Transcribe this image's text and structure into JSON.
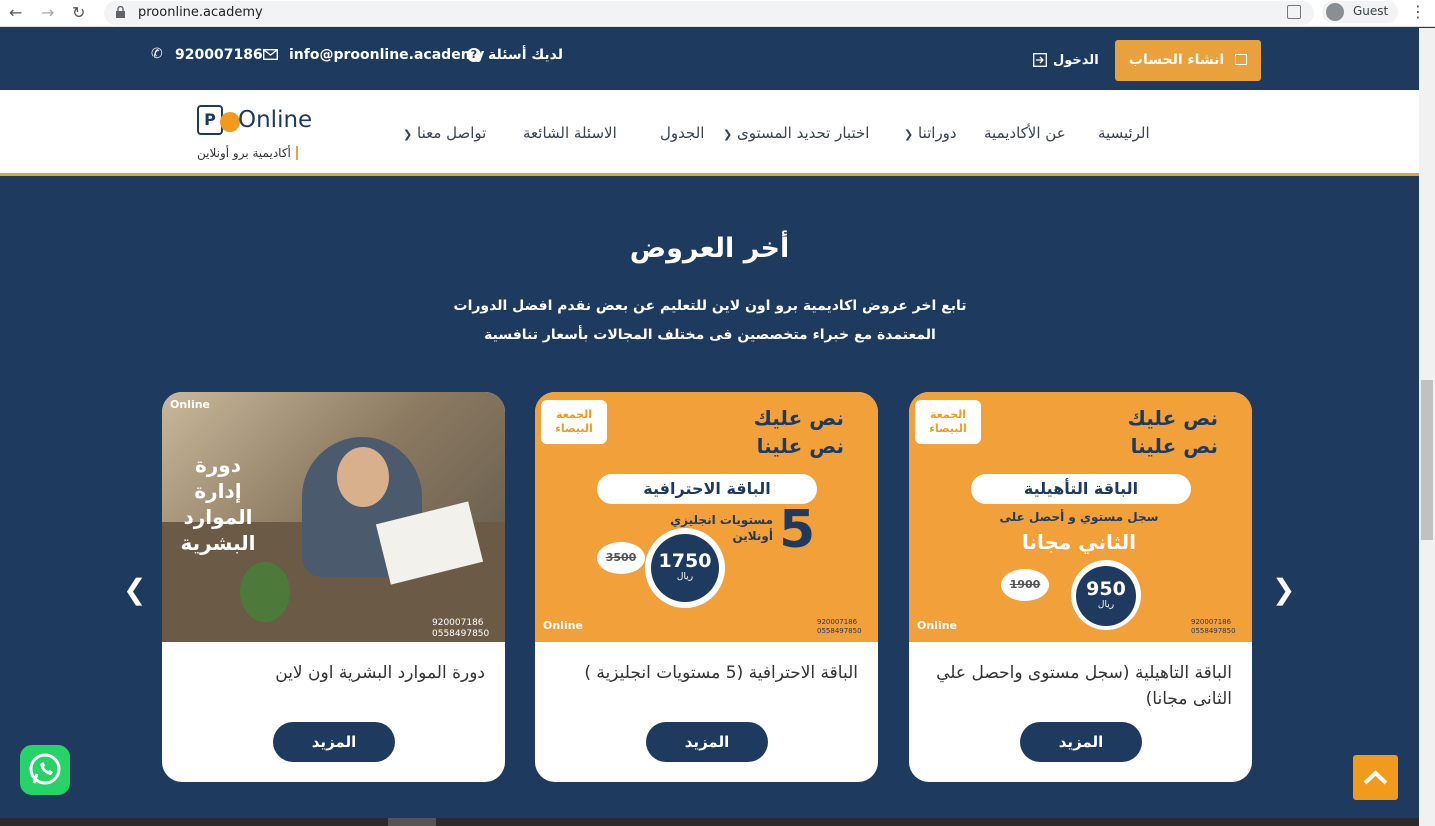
{
  "browser": {
    "url": "proonline.academy",
    "guest_label": "Guest"
  },
  "topbar": {
    "phone": "920007186",
    "email": "info@proonline.academy",
    "question": "لديك أسئلة",
    "login": "الدخول",
    "register": "انشاء الحساب"
  },
  "logo": {
    "text": "Online",
    "letter": "P",
    "subtitle": "أكاديمية برو أونلاين"
  },
  "nav": {
    "items": [
      {
        "label": "الرئيسية"
      },
      {
        "label": "عن الأكاديمية"
      },
      {
        "label": "دوراتنا"
      },
      {
        "label": "اختبار تحديد المستوى"
      },
      {
        "label": "الجدول"
      },
      {
        "label": "الاسئلة الشائعة"
      },
      {
        "label": "تواصل معنا"
      }
    ]
  },
  "offers": {
    "title": "أخر العروض",
    "desc_line1": "تابع اخر عروض اكاديمية برو اون لاين للتعليم عن بعض نقدم افضل الدورات",
    "desc_line2": "المعتمدة مع خبراء متخصصين فى مختلف المجالات بأسعار تنافسية"
  },
  "cards": [
    {
      "title": "الباقة التاهيلية (سجل مستوى واحصل علي الثانى مجانا)",
      "button": "المزيد",
      "img": {
        "headline1": "نص عليك",
        "headline2": "نص علينا",
        "pill": "الباقة التأهيلية",
        "line1": "سجل مستوي و أحصل على",
        "line2": "الثاني مجانا",
        "price": "950",
        "currency": "ريال",
        "old_price": "1900",
        "badge": "الجمعة البيضاء",
        "phone1": "920007186",
        "phone2": "0558497850",
        "brand": "Online"
      }
    },
    {
      "title": "الباقة الاحترافية (5 مستويات انجليزية )",
      "button": "المزيد",
      "img": {
        "headline1": "نص عليك",
        "headline2": "نص علينا",
        "pill": "الباقة الاحترافية",
        "big": "5",
        "line1": "مستويات انجليزي",
        "line2": "أونلاين",
        "price": "1750",
        "currency": "ريال",
        "old_price": "3500",
        "badge": "الجمعة البيضاء",
        "phone1": "920007186",
        "phone2": "0558497850",
        "brand": "Online"
      }
    },
    {
      "title": "دورة الموارد البشرية اون لاين",
      "button": "المزيد",
      "img": {
        "overlay": [
          "دورة",
          "إدارة",
          "الموارد",
          "البشرية"
        ],
        "phone1": "920007186",
        "phone2": "0558497850",
        "brand": "Online"
      }
    }
  ],
  "colors": {
    "navy": "#1f3a5f",
    "accent": "#e8a13c",
    "whatsapp": "#25d366"
  }
}
